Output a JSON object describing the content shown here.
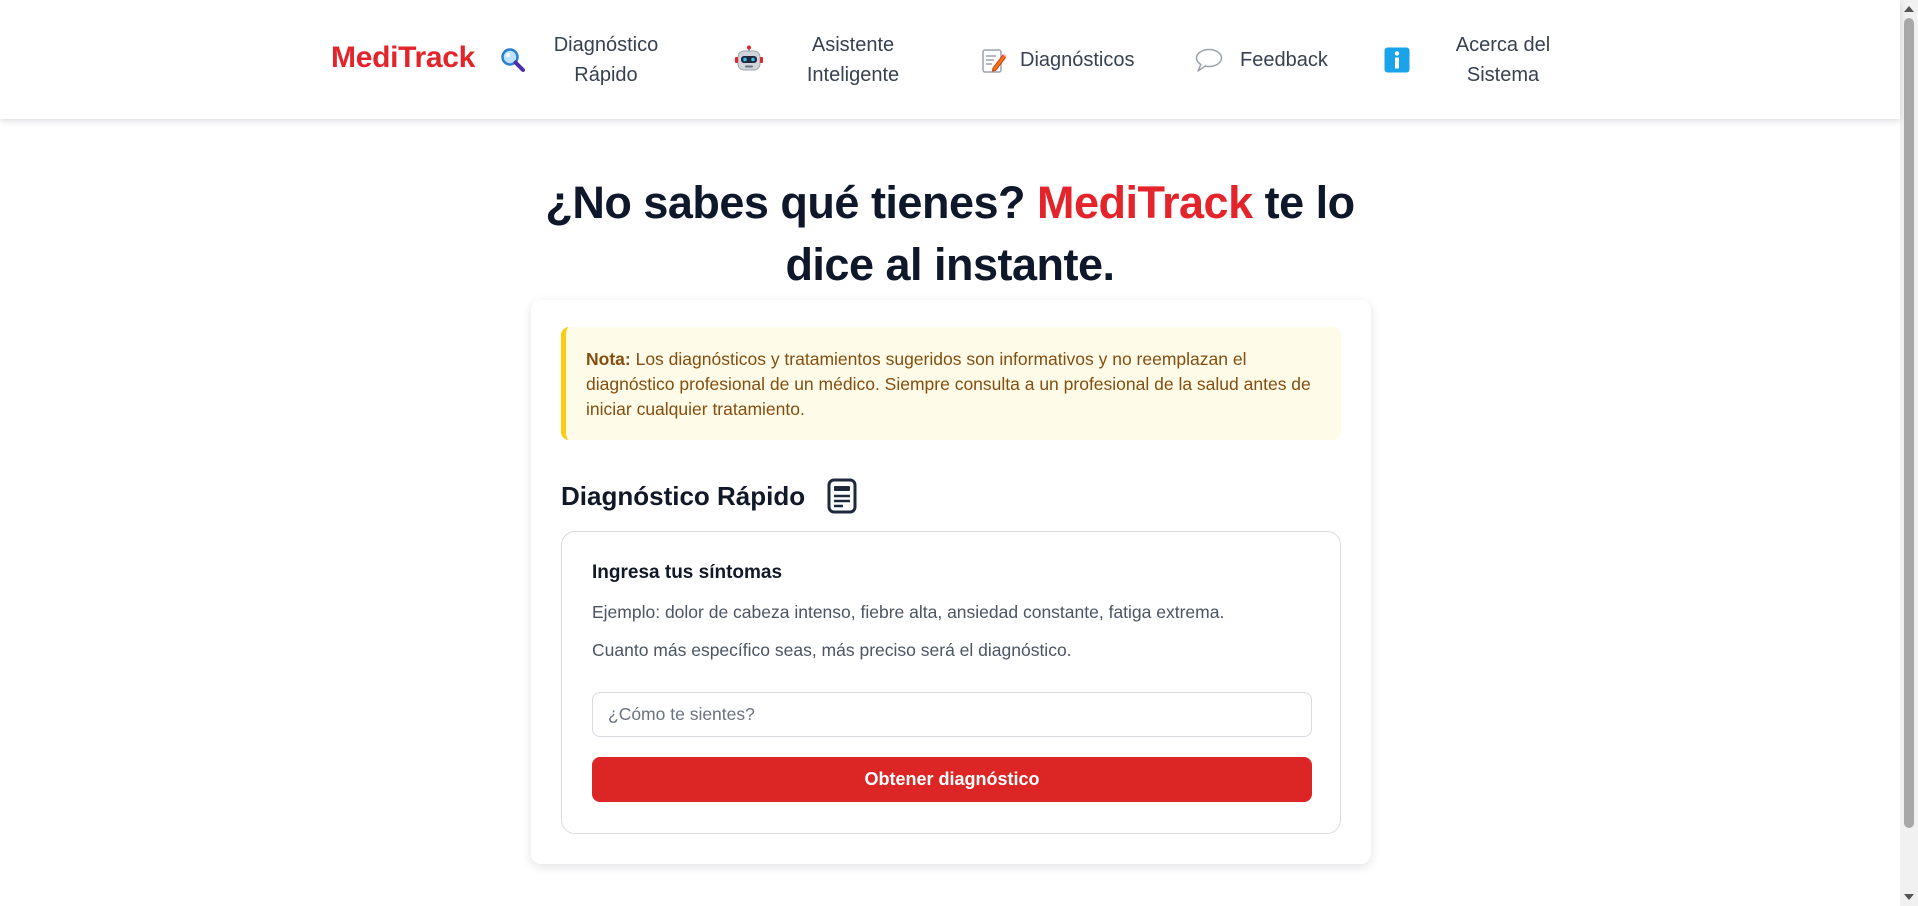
{
  "brand": {
    "name": "MediTrack",
    "color": "#e4242b"
  },
  "nav": {
    "items": [
      {
        "label": "Diagnóstico Rápido",
        "icon": "magnifier-icon"
      },
      {
        "label": "Asistente Inteligente",
        "icon": "robot-icon"
      },
      {
        "label": "Diagnósticos",
        "icon": "memo-icon"
      },
      {
        "label": "Feedback",
        "icon": "speech-bubble-icon"
      },
      {
        "label": "Acerca del Sistema",
        "icon": "info-icon"
      }
    ]
  },
  "hero": {
    "prefix": "¿No sabes qué tienes?",
    "brand": "MediTrack",
    "suffix": "te lo dice al instante."
  },
  "notice": {
    "label": "Nota:",
    "text": "Los diagnósticos y tratamientos sugeridos son informativos y no reemplazan el diagnóstico profesional de un médico. Siempre consulta a un profesional de la salud antes de iniciar cualquier tratamiento.",
    "background": "#fefbe8",
    "border_color": "#facc15",
    "text_color": "#854d0e"
  },
  "section": {
    "title": "Diagnóstico Rápido",
    "icon": "document-icon"
  },
  "form": {
    "heading": "Ingresa tus síntomas",
    "example": "Ejemplo: dolor de cabeza intenso, fiebre alta, ansiedad constante, fatiga extrema.",
    "hint": "Cuanto más específico seas, más preciso será el diagnóstico.",
    "input_value": "",
    "input_placeholder": "¿Cómo te sientes?",
    "submit_label": "Obtener diagnóstico",
    "submit_color": "#dc2626"
  }
}
